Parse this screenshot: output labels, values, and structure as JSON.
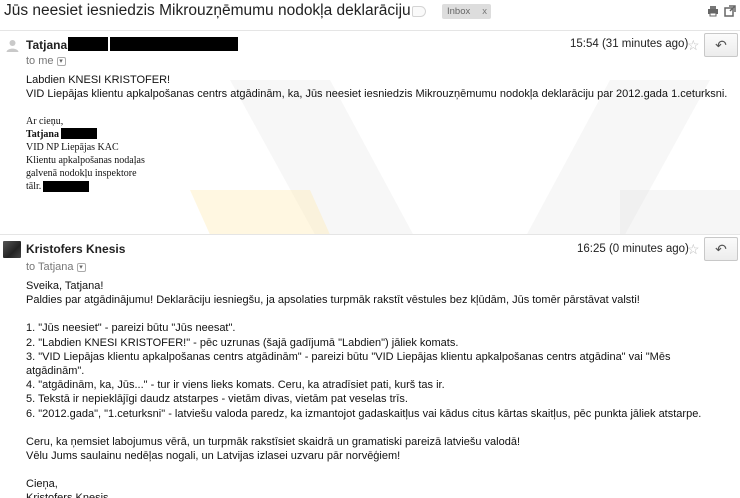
{
  "subject": "Jūs neesiet iesniedzis Mikrouzņēmumu nodokļa deklarāciju",
  "inbox_label": "Inbox",
  "inbox_remove": "x",
  "icons": {
    "label_tag": "label-tag-icon",
    "print": "print-icon",
    "new_window": "new-window-icon",
    "star": "star-icon",
    "reply": "reply-icon",
    "details_dropdown": "chevron-down-icon"
  },
  "message1": {
    "sender": "Tatjana",
    "to": "to me",
    "time": "15:54 (31 minutes ago)",
    "greeting": "Labdien KNESI KRISTOFER!",
    "text": "VID Liepājas klientu apkalpošanas centrs  atgādinām, ka, Jūs neesiet iesniedzis Mikrouzņēmumu nodokļa  deklarāciju  par 2012.gada   1.ceturksni.",
    "signature": {
      "closing": "Ar cieņu,",
      "name": "Tatjana",
      "line1": "VID NP Liepājas KAC",
      "line2": "Klientu apkalpošanas nodaļas",
      "line3": "galvenā nodokļu inspektore",
      "phone_label": "tālr."
    }
  },
  "message2": {
    "sender": "Kristofers Knesis",
    "to": "to Tatjana",
    "time": "16:25 (0 minutes ago)",
    "lines": [
      "Sveika, Tatjana!",
      "Paldies par atgādinājumu! Deklarāciju iesniegšu, ja apsolaties turpmāk rakstīt vēstules bez kļūdām, Jūs tomēr pārstāvat valsti!",
      "",
      "1. \"Jūs neesiet\" - pareizi būtu \"Jūs neesat\".",
      "2. \"Labdien KNESI KRISTOFER!\" - pēc uzrunas (šajā gadījumā \"Labdien\") jāliek komats.",
      "3. \"VID Liepājas klientu apkalpošanas centrs atgādinām\" - pareizi būtu \"VID Liepājas klientu apkalpošanas centrs atgādina\" vai \"Mēs",
      "atgādinām\".",
      "4. \"atgādinām, ka, Jūs...\" - tur ir viens lieks komats. Ceru, ka atradīsiet pati, kurš tas ir.",
      "5. Tekstā ir nepieklājīgi daudz atstarpes - vietām divas, vietām pat veselas trīs.",
      "6. \"2012.gada\", \"1.ceturksni\" - latviešu valoda paredz, ka izmantojot gadaskaitļus vai kādus citus kārtas skaitļus, pēc punkta jāliek atstarpe.",
      "",
      "Ceru, ka ņemsiet labojumus vērā, un turpmāk rakstīsiet skaidrā un gramatiski pareizā latviešu valodā!",
      "Vēlu Jums saulainu nedēļas nogali, un Latvijas izlasei uzvaru pār norvēģiem!",
      "",
      "Cieņa,",
      "Kristofers Knesis"
    ]
  }
}
